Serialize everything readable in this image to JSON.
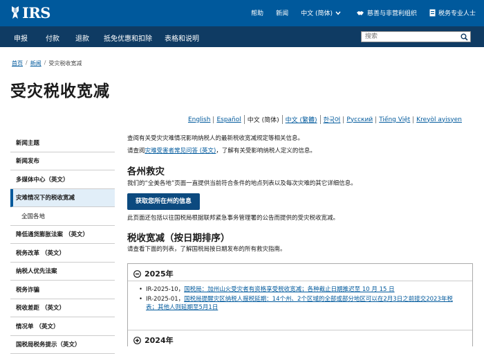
{
  "header": {
    "logo_text": "IRS",
    "links": {
      "help": "帮助",
      "news": "新闻",
      "language": "中文 (简体)",
      "charities": "慈善与非营利组织",
      "tax_pros": "税务专业人士"
    }
  },
  "nav": {
    "items": [
      "申报",
      "付款",
      "退款",
      "抵免优惠和扣除",
      "表格和说明"
    ],
    "search_placeholder": "搜索"
  },
  "breadcrumb": {
    "home": "首页",
    "news": "新闻",
    "current": "受灾税收宽减"
  },
  "page_title": "受灾税收宽减",
  "languages": [
    {
      "label": "English",
      "current": false
    },
    {
      "label": "Español",
      "current": false
    },
    {
      "label": "中文 (简体)",
      "current": true
    },
    {
      "label": "中文 (繁體)",
      "current": false
    },
    {
      "label": "한국어",
      "current": false
    },
    {
      "label": "Русский",
      "current": false
    },
    {
      "label": "Tiếng Việt",
      "current": false
    },
    {
      "label": "Kreyòl ayisyen",
      "current": false
    }
  ],
  "sidebar": {
    "items": [
      {
        "label": "新闻主题",
        "active": false,
        "sub": false
      },
      {
        "label": "新闻发布",
        "active": false,
        "sub": false
      },
      {
        "label": "多媒体中心（英文）",
        "active": false,
        "sub": false
      },
      {
        "label": "灾难情况下的税收宽减",
        "active": true,
        "sub": false
      },
      {
        "label": "全国各地",
        "active": false,
        "sub": true
      },
      {
        "label": "降低通货膨胀法案 （英文）",
        "active": false,
        "sub": false
      },
      {
        "label": "税务改革 （英文）",
        "active": false,
        "sub": false
      },
      {
        "label": "纳税人优先法案",
        "active": false,
        "sub": false
      },
      {
        "label": "税务诈骗",
        "active": false,
        "sub": false
      },
      {
        "label": "税收差距 （英文）",
        "active": false,
        "sub": false
      },
      {
        "label": "情况单 （英文）",
        "active": false,
        "sub": false
      },
      {
        "label": "国税局税务提示（英文）",
        "active": false,
        "sub": false
      }
    ]
  },
  "main": {
    "intro1": "查阅有关受灾灾难情况影响纳税人的最新税收宽减规定等相关信息。",
    "intro2_prefix": "请查阅",
    "intro2_link": "灾难受害者常见问答 (英文)",
    "intro2_suffix": "，了解有关受影响纳税人定义的信息。",
    "section1_title": "各州救灾",
    "section1_text": "我们的“全美各地”页面一直提供当前符合条件的地点列表以及每次灾难的其它详细信息。",
    "button_label": "获取您所在州的信息",
    "section1_note": "此页面还包括以往国税局根据联邦紧急事务管理署的公告而提供的受灾税收宽减。",
    "section2_title": "税收宽减（按日期排序）",
    "section2_text": "请查看下面的列表，了解国税局按日期发布的所有救灾指南。"
  },
  "accordion": {
    "year_open": "2025年",
    "items": [
      {
        "prefix": "IR-2025-10，",
        "link": "国税局：加州山火受灾者有资格享受税收宽减；各种截止日期推迟至 10 月 15 日"
      },
      {
        "prefix": "IR-2025-01，",
        "link": "国税局提醒灾区纳税人报税延期：14个州、2个区域的全部或部分地区可以在2月3日之前接交2023年税表；其他人则延期至5月1日"
      }
    ],
    "year_closed": "2024年"
  }
}
